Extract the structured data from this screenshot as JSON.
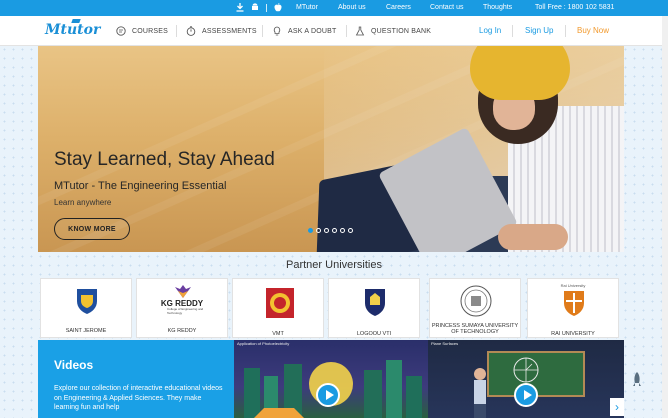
{
  "topbar": {
    "icons": [
      "download-icon",
      "android-icon",
      "apple-icon"
    ],
    "links": [
      "MTutor",
      "About us",
      "Careers",
      "Contact us",
      "Thoughts"
    ],
    "toll_free": "Toll Free : 1800 102 5831"
  },
  "navbar": {
    "logo": "Mtutor",
    "items": [
      {
        "label": "COURSES",
        "icon": "courses-icon"
      },
      {
        "label": "ASSESSMENTS",
        "icon": "stopwatch-icon"
      },
      {
        "label": "ASK A DOUBT",
        "icon": "lightbulb-icon"
      },
      {
        "label": "QUESTION BANK",
        "icon": "flask-icon"
      }
    ],
    "login": "Log In",
    "signup": "Sign Up",
    "buy": "Buy Now"
  },
  "hero": {
    "title": "Stay Learned, Stay Ahead",
    "subtitle": "MTutor - The Engineering Essential",
    "tagline": "Learn anywhere",
    "cta": "KNOW MORE",
    "slide_count": 6,
    "active_slide": 1
  },
  "partners": {
    "title": "Partner Universities",
    "items": [
      {
        "name": "SAINT JEROME",
        "emblem_color": "#1f4f9e"
      },
      {
        "name": "KG REDDY",
        "emblem_color": "#6a3ea1",
        "logo_text": "KG REDDY",
        "logo_sub": "College of Engineering and Technology"
      },
      {
        "name": "VMT",
        "emblem_color": "#c4242b"
      },
      {
        "name": "LOGOOU VTI",
        "emblem_color": "#1d2c6b"
      },
      {
        "name": "PRINCESS SUMAYA UNIVERSITY OF TECHNOLOGY",
        "emblem_color": "#555555"
      },
      {
        "name": "RAI UNIVERSITY",
        "emblem_color": "#e07b1a",
        "logo_text": "Rai University"
      }
    ]
  },
  "videos": {
    "title": "Videos",
    "description": "Explore our collection of interactive educational videos on Engineering & Applied Sciences. They make learning fun and help",
    "cards": [
      {
        "label": "Application of Photoelectricity"
      },
      {
        "label": "Plane Surfaces"
      }
    ]
  },
  "colors": {
    "primary": "#1a9be2",
    "buy": "#f29a2e",
    "hero_bg": "#ddb06a"
  }
}
